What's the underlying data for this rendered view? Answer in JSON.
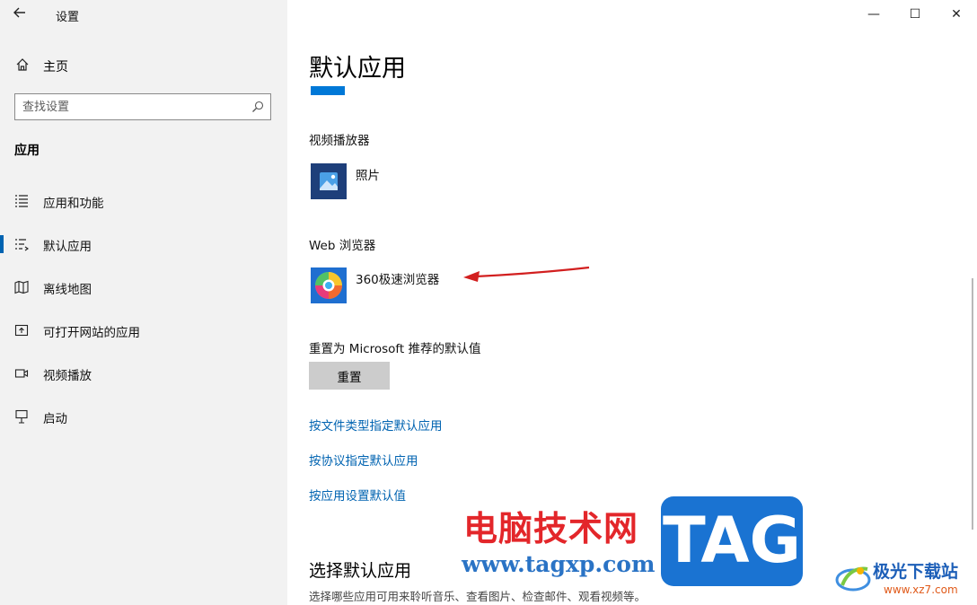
{
  "window": {
    "title": "设置"
  },
  "sidebar": {
    "home_label": "主页",
    "search_placeholder": "查找设置",
    "section_title": "应用",
    "items": [
      {
        "label": "应用和功能",
        "icon": "apps-features-icon"
      },
      {
        "label": "默认应用",
        "icon": "default-apps-icon",
        "active": true
      },
      {
        "label": "离线地图",
        "icon": "offline-maps-icon"
      },
      {
        "label": "可打开网站的应用",
        "icon": "apps-for-websites-icon"
      },
      {
        "label": "视频播放",
        "icon": "video-playback-icon"
      },
      {
        "label": "启动",
        "icon": "startup-icon"
      }
    ]
  },
  "titlebar": {
    "minimize": "—",
    "maximize": "☐",
    "close": "✕"
  },
  "main": {
    "title": "默认应用",
    "video_player": {
      "label": "视频播放器",
      "app": "照片"
    },
    "web_browser": {
      "label": "Web 浏览器",
      "app": "360极速浏览器"
    },
    "reset": {
      "label": "重置为 Microsoft 推荐的默认值",
      "button": "重置"
    },
    "links": [
      "按文件类型指定默认应用",
      "按协议指定默认应用",
      "按应用设置默认值"
    ],
    "choose_title": "选择默认应用",
    "choose_desc": "选择哪些应用可用来聆听音乐、查看图片、检查邮件、观看视频等。"
  },
  "watermark": {
    "site_name": "电脑技术网",
    "site_url": "www.tagxp.com",
    "tag": "TAG",
    "brand2": "极光下载站",
    "brand2_url": "www.xz7.com"
  },
  "colors": {
    "accent": "#0078d7",
    "link": "#0063b1",
    "arrow": "#d21f1f"
  }
}
